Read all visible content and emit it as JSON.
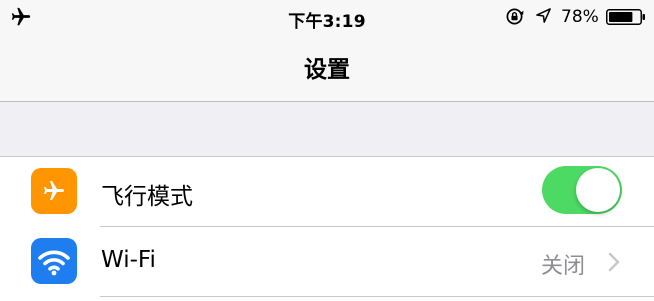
{
  "status_bar": {
    "time": "下午3:19",
    "battery_percent": "78%",
    "battery_level": 0.78,
    "icons": [
      "airplane-icon",
      "orientation-lock-icon",
      "location-icon",
      "battery-icon"
    ]
  },
  "nav": {
    "title": "设置"
  },
  "settings": {
    "rows": [
      {
        "label": "飞行模式",
        "icon": "airplane-icon",
        "icon_color": "#ff9500",
        "toggle_on": true,
        "toggle_color": "#4cd964"
      },
      {
        "label": "Wi-Fi",
        "icon": "wifi-icon",
        "icon_color": "#1e7ef0",
        "value": "关闭"
      }
    ]
  },
  "colors": {
    "accent_green": "#4cd964",
    "background": "#efeff4",
    "secondary_text": "#8e8e93"
  }
}
